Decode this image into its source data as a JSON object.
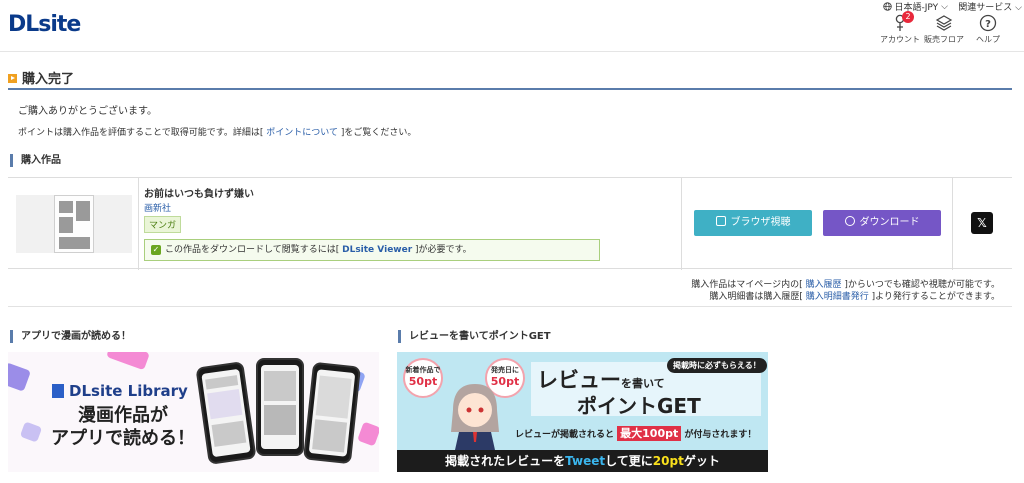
{
  "header": {
    "logo": "DLsite",
    "language": "日本語-JPY",
    "related": "関連サービス",
    "account_label": "アカウント",
    "account_badge": "2",
    "floor_label": "販売フロア",
    "help_label": "ヘルプ"
  },
  "page": {
    "title": "購入完了",
    "thanks": "ご購入ありがとうございます。",
    "point_pre": "ポイントは購入作品を評価することで取得可能です。詳細は[ ",
    "point_link": "ポイントについて",
    "point_post": " ]をご覧ください。"
  },
  "purchased": {
    "heading": "購入作品",
    "item": {
      "title": "お前はいつも負けず嫌い",
      "maker": "画新社",
      "genre": "マンガ",
      "note_pre": "この作品をダウンロードして閲覧するには[ ",
      "note_link": "DLsite Viewer",
      "note_post": " ]が必要です。"
    },
    "browser_button": "ブラウザ視聴",
    "download_button": "ダウンロード",
    "x_button": "𝕏"
  },
  "history": {
    "line1_pre": "購入作品はマイページ内の[ ",
    "line1_link": "購入履歴",
    "line1_post": " ]からいつでも確認や視聴が可能です。",
    "line2_pre": "購入明細書は購入履歴[ ",
    "line2_link": "購入明細書発行",
    "line2_post": " ]より発行することができます。"
  },
  "app_section": {
    "heading": "アプリで漫画が読める！",
    "logo": "DLsite Library",
    "line1": "漫画作品が",
    "line2": "アプリで読める！"
  },
  "review_section": {
    "heading": "レビューを書いてポイントGET",
    "bubble1_small": "新着作品で",
    "bubble1_big": "50pt",
    "bubble2_small": "発売日に",
    "bubble2_big": "50pt",
    "tag": "掲載時に必ずもらえる！",
    "title1": "レビュー",
    "title1_small": "を書いて",
    "title2": "ポイントGET",
    "sub_pre": "レビューが掲載されると ",
    "sub_hl": "最大100pt",
    "sub_post": " が付与されます！",
    "bottom_pre": "掲載されたレビューを",
    "bottom_tw": "Tweet",
    "bottom_mid": "して更に",
    "bottom_pt": "20pt",
    "bottom_post": "ゲット"
  }
}
